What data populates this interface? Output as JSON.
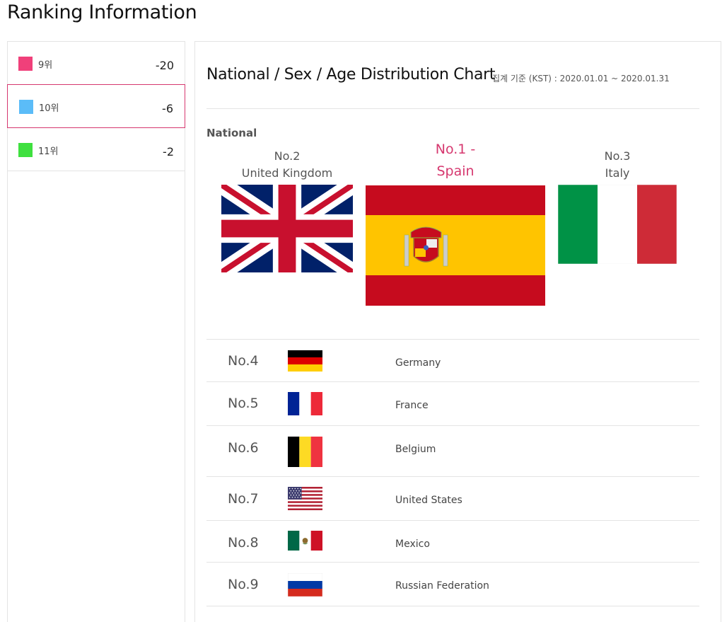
{
  "page": {
    "title": "Ranking Information"
  },
  "sidebar": {
    "items": [
      {
        "label": "9위",
        "change": "-20",
        "color": "#f0407a"
      },
      {
        "label": "10위",
        "change": "-6",
        "color": "#5bbcf8",
        "selected": true
      },
      {
        "label": "11위",
        "change": "-2",
        "color": "#3fe03f"
      }
    ]
  },
  "main": {
    "title": "National / Sex / Age Distribution Chart",
    "period": "집계 기준 (KST) : 2020.01.01 ~ 2020.01.31",
    "section": "National",
    "accent_color": "#d6386f",
    "podium": [
      {
        "rank": "No.1 -",
        "country": "Spain",
        "flag": "spain-flag-icon"
      },
      {
        "rank": "No.2",
        "country": "United Kingdom",
        "flag": "uk-flag-icon"
      },
      {
        "rank": "No.3",
        "country": "Italy",
        "flag": "italy-flag-icon"
      }
    ],
    "list": [
      {
        "rank": "No.4",
        "country": "Germany",
        "flag": "germany-flag-icon"
      },
      {
        "rank": "No.5",
        "country": "France",
        "flag": "france-flag-icon"
      },
      {
        "rank": "No.6",
        "country": "Belgium",
        "flag": "belgium-flag-icon"
      },
      {
        "rank": "No.7",
        "country": "United States",
        "flag": "usa-flag-icon"
      },
      {
        "rank": "No.8",
        "country": "Mexico",
        "flag": "mexico-flag-icon"
      },
      {
        "rank": "No.9",
        "country": "Russian Federation",
        "flag": "russia-flag-icon"
      }
    ]
  }
}
